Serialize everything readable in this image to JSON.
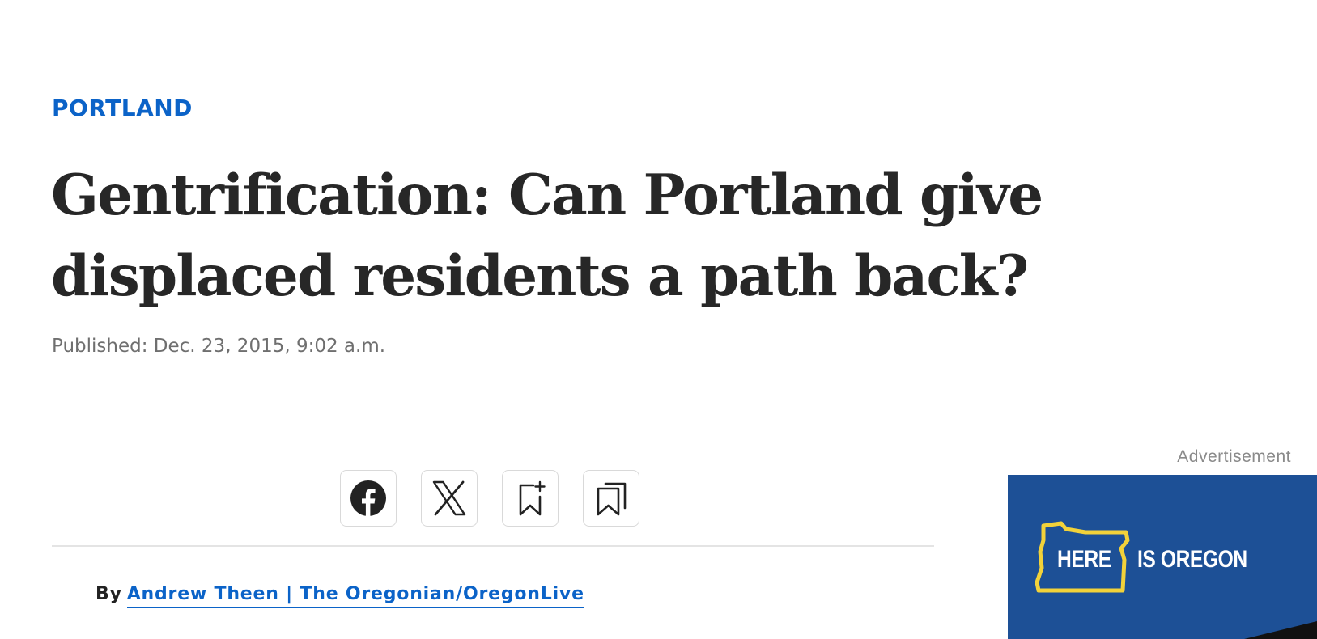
{
  "article": {
    "section": "PORTLAND",
    "headline": "Gentrification: Can Portland give displaced residents a path back?",
    "published": "Published: Dec. 23, 2015, 9:02 a.m."
  },
  "share": {
    "buttons": [
      {
        "icon": "facebook-icon"
      },
      {
        "icon": "x-icon"
      },
      {
        "icon": "bookmark-add-icon"
      },
      {
        "icon": "saved-bookmarks-icon"
      }
    ]
  },
  "byline": {
    "prefix": "By",
    "author": "Andrew Theen | The Oregonian/OregonLive"
  },
  "advertisement": {
    "label": "Advertisement",
    "text_left": "HERE",
    "text_right": "IS OREGON",
    "background_color": "#1d5096",
    "outline_color": "#f2d23a"
  },
  "colors": {
    "accent": "#0b63c8",
    "headline": "#272727",
    "meta": "#6f6f6f"
  }
}
